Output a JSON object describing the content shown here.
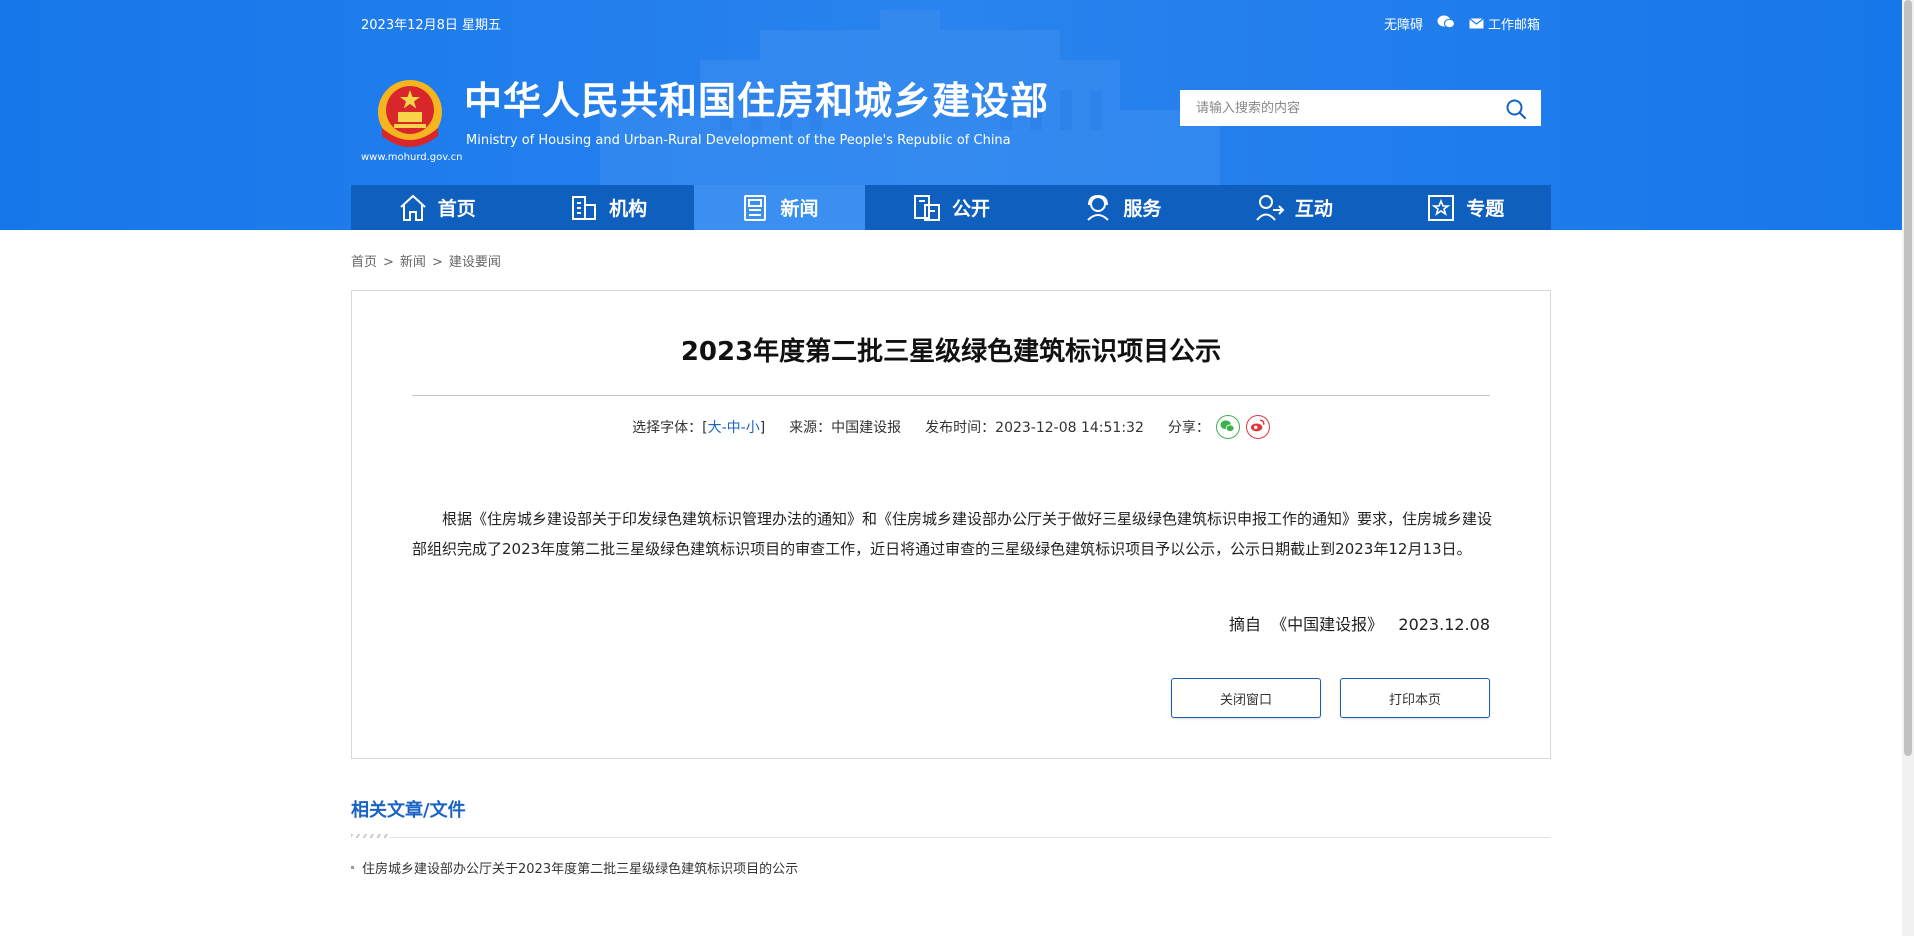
{
  "topbar": {
    "date": "2023年12月8日 星期五",
    "accessibility": "无障碍",
    "mail": "工作邮箱"
  },
  "brand": {
    "title": "中华人民共和国住房和城乡建设部",
    "subtitle": "Ministry of Housing and Urban-Rural Development of the People's Republic of China",
    "url": "www.mohurd.gov.cn"
  },
  "search": {
    "placeholder": "请输入搜索的内容"
  },
  "nav": {
    "items": [
      {
        "label": "首页",
        "icon": "home-icon"
      },
      {
        "label": "机构",
        "icon": "building-icon"
      },
      {
        "label": "新闻",
        "icon": "news-icon",
        "active": true
      },
      {
        "label": "公开",
        "icon": "disclosure-icon"
      },
      {
        "label": "服务",
        "icon": "service-icon"
      },
      {
        "label": "互动",
        "icon": "interaction-icon"
      },
      {
        "label": "专题",
        "icon": "topic-icon"
      }
    ]
  },
  "breadcrumb": {
    "items": [
      "首页",
      "新闻",
      "建设要闻"
    ],
    "separator": ">"
  },
  "article": {
    "title": "2023年度第二批三星级绿色建筑标识项目公示",
    "font_select_label": "选择字体：[",
    "font_large": "大",
    "font_medium": "中",
    "font_small": "小",
    "font_dash": "-",
    "font_close": "]",
    "source": "来源：中国建设报",
    "pubtime": "发布时间：2023-12-08 14:51:32",
    "share_label": "分享：",
    "body": "根据《住房城乡建设部关于印发绿色建筑标识管理办法的通知》和《住房城乡建设部办公厅关于做好三星级绿色建筑标识申报工作的通知》要求，住房城乡建设部组织完成了2023年度第二批三星级绿色建筑标识项目的审查工作，近日将通过审查的三星级绿色建筑标识项目予以公示，公示日期截止到2023年12月13日。",
    "excerpt": "摘自  《中国建设报》   2023.12.08",
    "close_button": "关闭窗口",
    "print_button": "打印本页"
  },
  "related": {
    "title": "相关文章/文件",
    "items": [
      "住房城乡建设部办公厅关于2023年度第二批三星级绿色建筑标识项目的公示"
    ]
  },
  "colors": {
    "header_blue": "#1a78e8",
    "nav_blue": "#0f5fbf",
    "nav_active": "#3a8ff0",
    "link_blue": "#1a63c4"
  }
}
